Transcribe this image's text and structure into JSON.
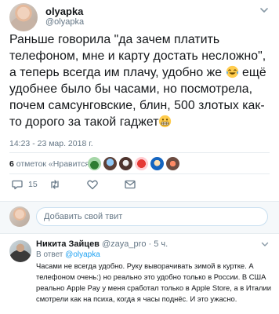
{
  "tweet": {
    "author_name": "olyapka",
    "author_handle": "@olyapka",
    "text_parts": [
      "Раньше говорила \"да зачем платить телефоном, мне и карту достать несложно\", а теперь всегда им плачу, удобно же ",
      " ещё удобнее было бы часами, но посмотрела, почем самсунговские, блин, 500 злотых как-то дорого за такой гаджет"
    ],
    "emoji": [
      "laughing-tears-emoji",
      "grimacing-emoji"
    ],
    "timestamp": "14:23 - 23 мар. 2018 г.",
    "likes_count": "6",
    "likes_label": "отметок «Нравится»",
    "reply_count": "15"
  },
  "reply_box": {
    "placeholder": "Добавить свой твит"
  },
  "reply": {
    "author_name": "Никита Зайцев",
    "author_handle": "@zaya_pro",
    "time": "5 ч.",
    "in_reply_prefix": "В ответ",
    "in_reply_to": "@olyapka",
    "text": "Часами не всегда удобно. Руку выворачивать зимой в куртке. А телефоном очень:) но реально это удобно только в России. В США реально Apple Pay у меня сработал только в Apple Store, а в Италии смотрели как на психа, когда я часы поднёс. И это ужасно."
  },
  "colors": {
    "accent": "#1da1f2",
    "muted": "#657786",
    "divider": "#e6ecf0"
  }
}
